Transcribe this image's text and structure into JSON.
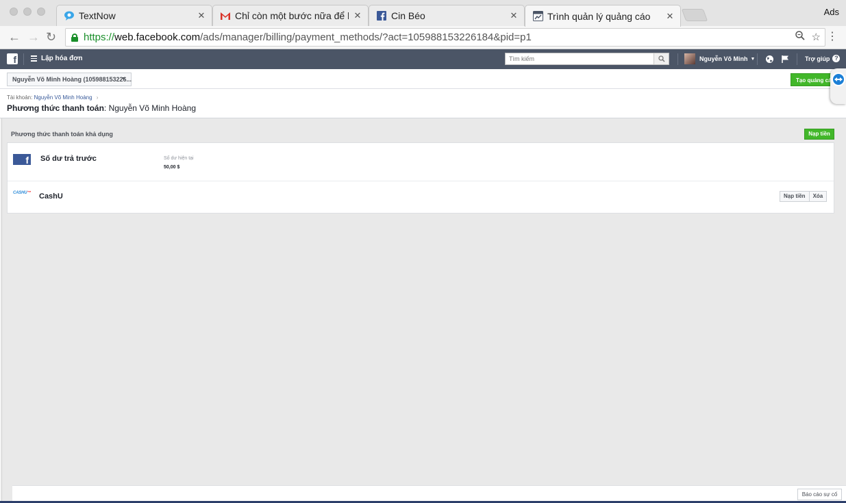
{
  "browser": {
    "tabs": [
      {
        "title": "TextNow",
        "icon": "textnow-icon"
      },
      {
        "title": "Chỉ còn một bước nữa để bắt",
        "icon": "gmail-icon"
      },
      {
        "title": "Cin Béo",
        "icon": "facebook-icon"
      },
      {
        "title": "Trình quản lý quảng cáo",
        "icon": "ads-manager-icon"
      }
    ],
    "corner_label": "Ads",
    "url": {
      "scheme": "https://",
      "host": "web.facebook.com",
      "path": "/ads/manager/billing/payment_methods/?act=105988153226184&pid=p1"
    }
  },
  "fbbar": {
    "section_title": "Lập hóa đơn",
    "search_placeholder": "Tìm kiếm",
    "user_name": "Nguyễn Võ Minh",
    "help_label": "Trợ giúp"
  },
  "account": {
    "selector_label": "Nguyễn Võ Minh Hoàng (105988153226...",
    "create_ad_label": "Tạo quảng cáo"
  },
  "header": {
    "breadcrumb_prefix": "Tài khoản:",
    "breadcrumb_link": "Nguyễn Võ Minh Hoàng",
    "title_bold": "Phương thức thanh toán",
    "title_rest": ": Nguyễn Võ Minh Hoàng"
  },
  "payments": {
    "section_title": "Phương thức thanh toán khả dụng",
    "topup_label": "Nạp tiền",
    "methods": [
      {
        "name": "Số dư trả trước",
        "balance_label": "Số dư hiện tại",
        "balance_value": "50,00 $"
      },
      {
        "name": "CashU",
        "logo_text": "CASHU",
        "logo_mark": "™",
        "topup_label": "Nạp tiền",
        "delete_label": "Xóa"
      }
    ]
  },
  "footer": {
    "report_label": "Báo cáo sự cố"
  },
  "colors": {
    "fb_bar": "#4b5566",
    "primary_green": "#42b72a",
    "fb_blue": "#3b5998",
    "link": "#365899"
  }
}
